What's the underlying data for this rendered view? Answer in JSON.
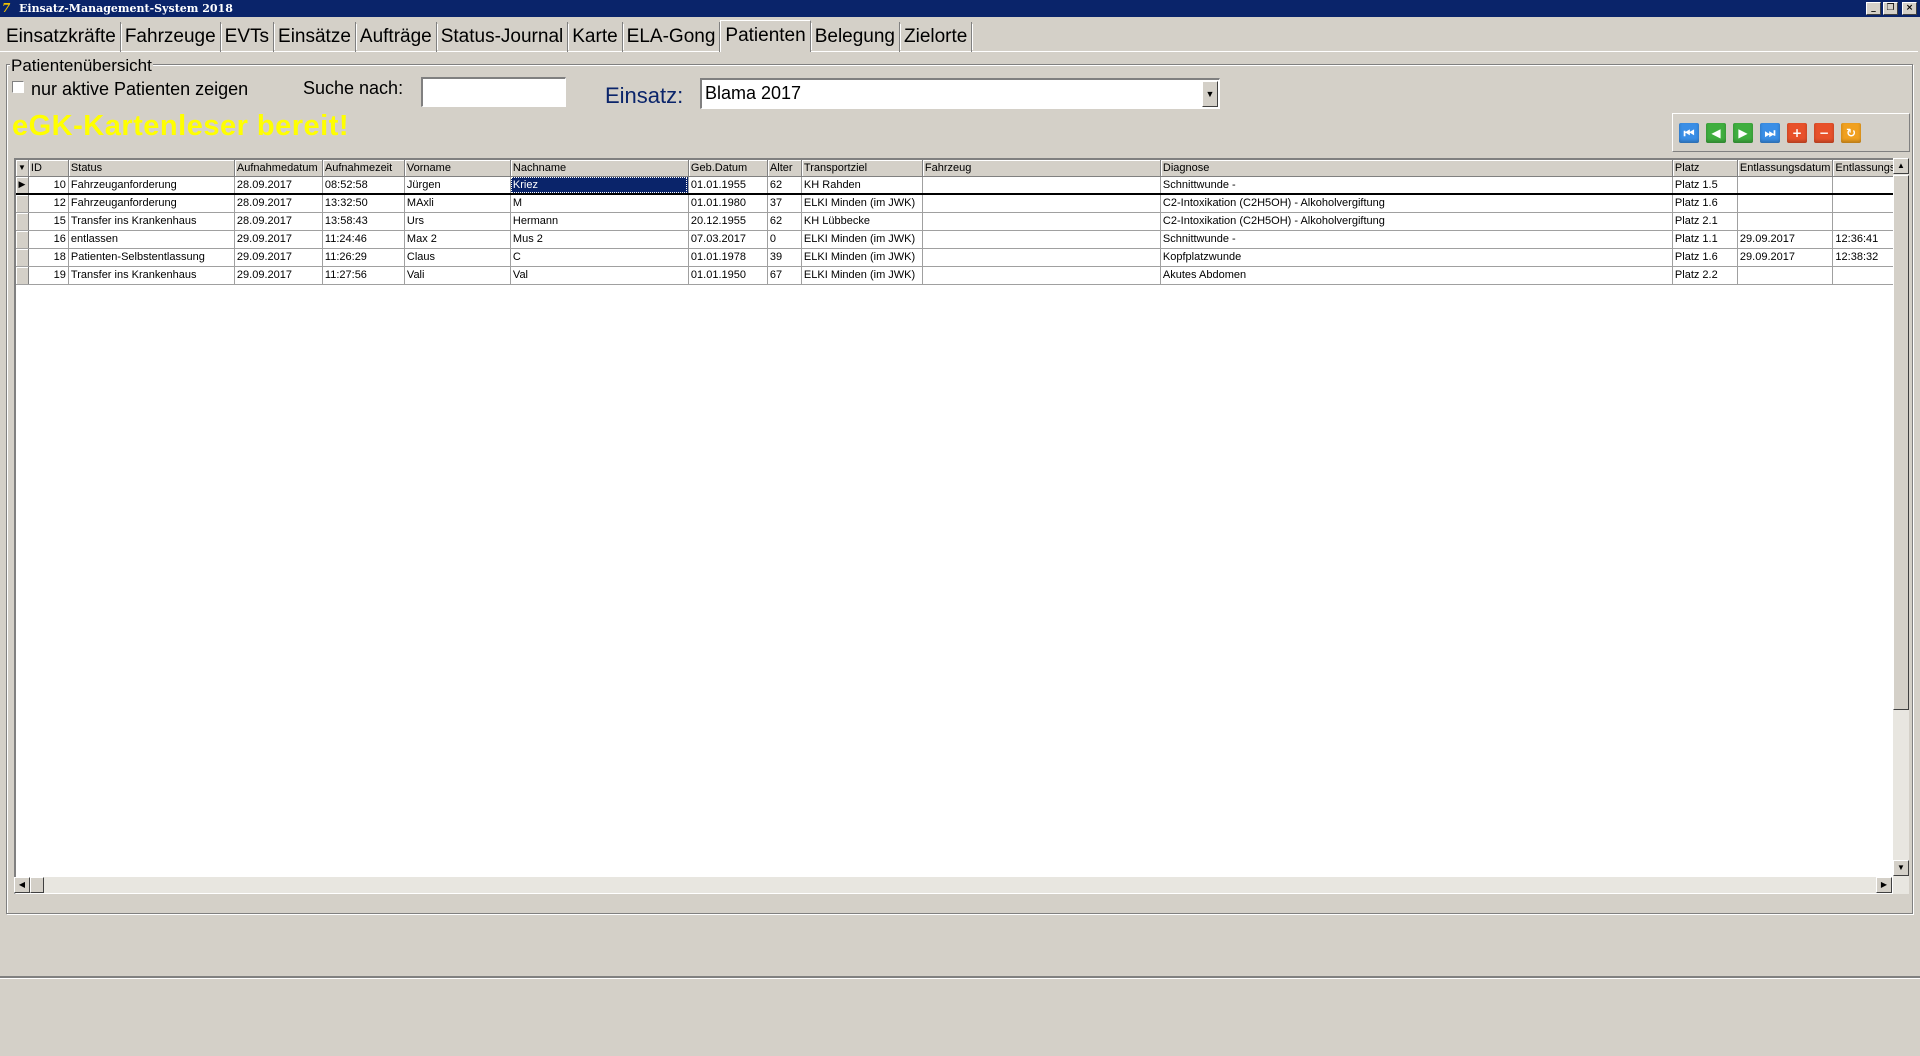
{
  "window": {
    "title": "Einsatz-Management-System 2018",
    "icon_char": "7",
    "controls": {
      "minimize": "_",
      "restore": "❐",
      "close": "×"
    }
  },
  "tabs": [
    {
      "label": "Einsatzkräfte",
      "active": false
    },
    {
      "label": "Fahrzeuge",
      "active": false
    },
    {
      "label": "EVTs",
      "active": false
    },
    {
      "label": "Einsätze",
      "active": false
    },
    {
      "label": "Aufträge",
      "active": false
    },
    {
      "label": "Status-Journal",
      "active": false
    },
    {
      "label": "Karte",
      "active": false
    },
    {
      "label": "ELA-Gong",
      "active": false
    },
    {
      "label": "Patienten",
      "active": true
    },
    {
      "label": "Belegung",
      "active": false
    },
    {
      "label": "Zielorte",
      "active": false
    }
  ],
  "overview": {
    "group_title": "Patientenübersicht",
    "active_only_label": "nur aktive Patienten zeigen",
    "active_only_checked": false,
    "search_label": "Suche nach:",
    "search_value": "",
    "einsatz_label": "Einsatz:",
    "einsatz_value": "Blama 2017",
    "egk_status": "eGK-Kartenleser bereit!"
  },
  "navigator": [
    {
      "name": "first-record-icon",
      "glyph": "⏮",
      "color": "#3a8ee6"
    },
    {
      "name": "prior-record-icon",
      "glyph": "◀",
      "color": "#3fae3f"
    },
    {
      "name": "next-record-icon",
      "glyph": "▶",
      "color": "#3fae3f"
    },
    {
      "name": "last-record-icon",
      "glyph": "⏭",
      "color": "#3a8ee6"
    },
    {
      "name": "insert-record-icon",
      "glyph": "+",
      "color": "#e8512a"
    },
    {
      "name": "delete-record-icon",
      "glyph": "−",
      "color": "#e8512a"
    },
    {
      "name": "refresh-icon",
      "glyph": "↻",
      "color": "#f0a020"
    }
  ],
  "grid": {
    "indicator_header": "▼",
    "columns": [
      "ID",
      "Status",
      "Aufnahmedatum",
      "Aufnahmezeit",
      "Vorname",
      "Nachname",
      "Geb.Datum",
      "Alter",
      "Transportziel",
      "Fahrzeug",
      "Diagnose",
      "Platz",
      "Entlassungsdatum",
      "Entlassungs"
    ],
    "rows": [
      {
        "id": "10",
        "status": "Fahrzeuganforderung",
        "aufnahmedatum": "28.09.2017",
        "aufnahmezeit": "08:52:58",
        "vorname": "Jürgen",
        "nachname": "Kriez",
        "geb": "01.01.1955",
        "alter": "62",
        "ziel": "KH Rahden",
        "fahrzeug": "",
        "diagnose": "Schnittwunde -",
        "platz": "Platz 1.5",
        "entl_datum": "",
        "entl_zeit": "",
        "current": true
      },
      {
        "id": "12",
        "status": "Fahrzeuganforderung",
        "aufnahmedatum": "28.09.2017",
        "aufnahmezeit": "13:32:50",
        "vorname": "MAxli",
        "nachname": "M",
        "geb": "01.01.1980",
        "alter": "37",
        "ziel": "ELKI Minden (im JWK)",
        "fahrzeug": "",
        "diagnose": "C2-Intoxikation (C2H5OH) - Alkoholvergiftung",
        "platz": "Platz 1.6",
        "entl_datum": "",
        "entl_zeit": "",
        "current": false
      },
      {
        "id": "15",
        "status": "Transfer ins Krankenhaus",
        "aufnahmedatum": "28.09.2017",
        "aufnahmezeit": "13:58:43",
        "vorname": "Urs",
        "nachname": "Hermann",
        "geb": "20.12.1955",
        "alter": "62",
        "ziel": "KH Lübbecke",
        "fahrzeug": "",
        "diagnose": "C2-Intoxikation (C2H5OH) - Alkoholvergiftung",
        "platz": "Platz 2.1",
        "entl_datum": "",
        "entl_zeit": "",
        "current": false
      },
      {
        "id": "16",
        "status": "entlassen",
        "aufnahmedatum": "29.09.2017",
        "aufnahmezeit": "11:24:46",
        "vorname": "Max 2",
        "nachname": "Mus 2",
        "geb": "07.03.2017",
        "alter": "0",
        "ziel": "ELKI Minden (im JWK)",
        "fahrzeug": "",
        "diagnose": "Schnittwunde -",
        "platz": "Platz 1.1",
        "entl_datum": "29.09.2017",
        "entl_zeit": "12:36:41",
        "current": false
      },
      {
        "id": "18",
        "status": "Patienten-Selbstentlassung",
        "aufnahmedatum": "29.09.2017",
        "aufnahmezeit": "11:26:29",
        "vorname": "Claus",
        "nachname": "C",
        "geb": "01.01.1978",
        "alter": "39",
        "ziel": "ELKI Minden (im JWK)",
        "fahrzeug": "",
        "diagnose": "Kopfplatzwunde",
        "platz": "Platz 1.6",
        "entl_datum": "29.09.2017",
        "entl_zeit": "12:38:32",
        "current": false
      },
      {
        "id": "19",
        "status": "Transfer ins Krankenhaus",
        "aufnahmedatum": "29.09.2017",
        "aufnahmezeit": "11:27:56",
        "vorname": "Vali",
        "nachname": "Val",
        "geb": "01.01.1950",
        "alter": "67",
        "ziel": "ELKI Minden (im JWK)",
        "fahrzeug": "",
        "diagnose": "Akutes Abdomen",
        "platz": "Platz 2.2",
        "entl_datum": "",
        "entl_zeit": "",
        "current": false
      }
    ]
  },
  "colors": {
    "title_bar": "#0a246a",
    "egk_status": "#ffff00",
    "einsatz_label": "#0a246a",
    "face": "#d4d0c8",
    "selection": "#0a246a"
  }
}
